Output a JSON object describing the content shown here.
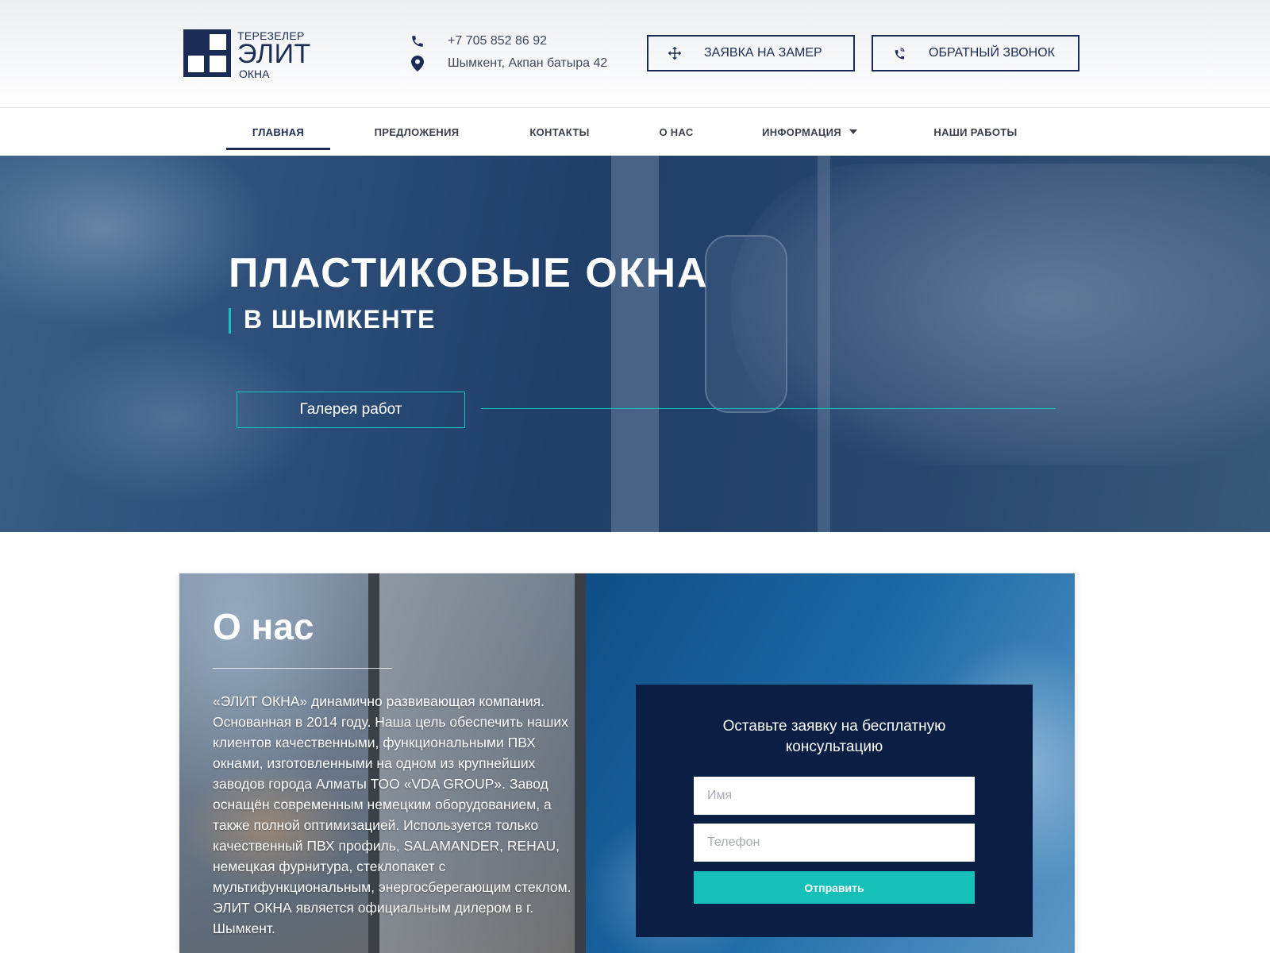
{
  "colors": {
    "brand_navy": "#1a2b55",
    "accent_teal": "#19c4c0",
    "form_bg": "#0b1f45",
    "submit_bg": "#16bfb8"
  },
  "logo": {
    "top_text": "ТЕРЕЗЕЛЕР",
    "main_text": "ЭЛИТ",
    "bottom_text": "ОКНА",
    "icon": "window-grid-icon"
  },
  "header": {
    "phone": "+7 705 852 86 92",
    "phone_icon": "phone-icon",
    "address": "Шымкент, Акпан батыра 42",
    "address_icon": "map-pin-icon",
    "measure_button": {
      "label": "ЗАЯВКА НА ЗАМЕР",
      "icon": "move-arrows-icon"
    },
    "callback_button": {
      "label": "ОБРАТНЫЙ ЗВОНОК",
      "icon": "phone-ringing-icon"
    }
  },
  "nav": {
    "items": [
      {
        "label": "ГЛАВНАЯ",
        "active": true
      },
      {
        "label": "ПРЕДЛОЖЕНИЯ",
        "active": false
      },
      {
        "label": "КОНТАКТЫ",
        "active": false
      },
      {
        "label": "О НАС",
        "active": false
      },
      {
        "label": "ИНФОРМАЦИЯ",
        "active": false,
        "dropdown": true
      },
      {
        "label": "НАШИ РАБОТЫ",
        "active": false
      }
    ]
  },
  "hero": {
    "title": "ПЛАСТИКОВЫЕ ОКНА",
    "subtitle": "В ШЫМКЕНТЕ",
    "button_label": "Галерея работ"
  },
  "about": {
    "title": "О нас",
    "text": "«ЭЛИТ ОКНА» динамично развивающая компания. Основанная в 2014 году. Наша цель обеспечить наших клиентов качественными, функциональными ПВХ окнами, изготовленными на одном из крупнейших заводов города Алматы ТОО «VDA GROUP». Завод оснащён современным немецким оборудованием, а также полной оптимизацией. Используется только качественный ПВХ профиль, SALAMANDER, REHAU, немецкая фурнитура, стеклопакет с мультифункциональным, энергосберегающим стеклом. ЭЛИТ ОКНА является официальным дилером в г. Шымкент."
  },
  "form": {
    "title": "Оставьте заявку на бесплатную консультацию",
    "name_placeholder": "Имя",
    "name_value": "",
    "phone_placeholder": "Телефон",
    "phone_value": "",
    "submit_label": "Отправить"
  }
}
